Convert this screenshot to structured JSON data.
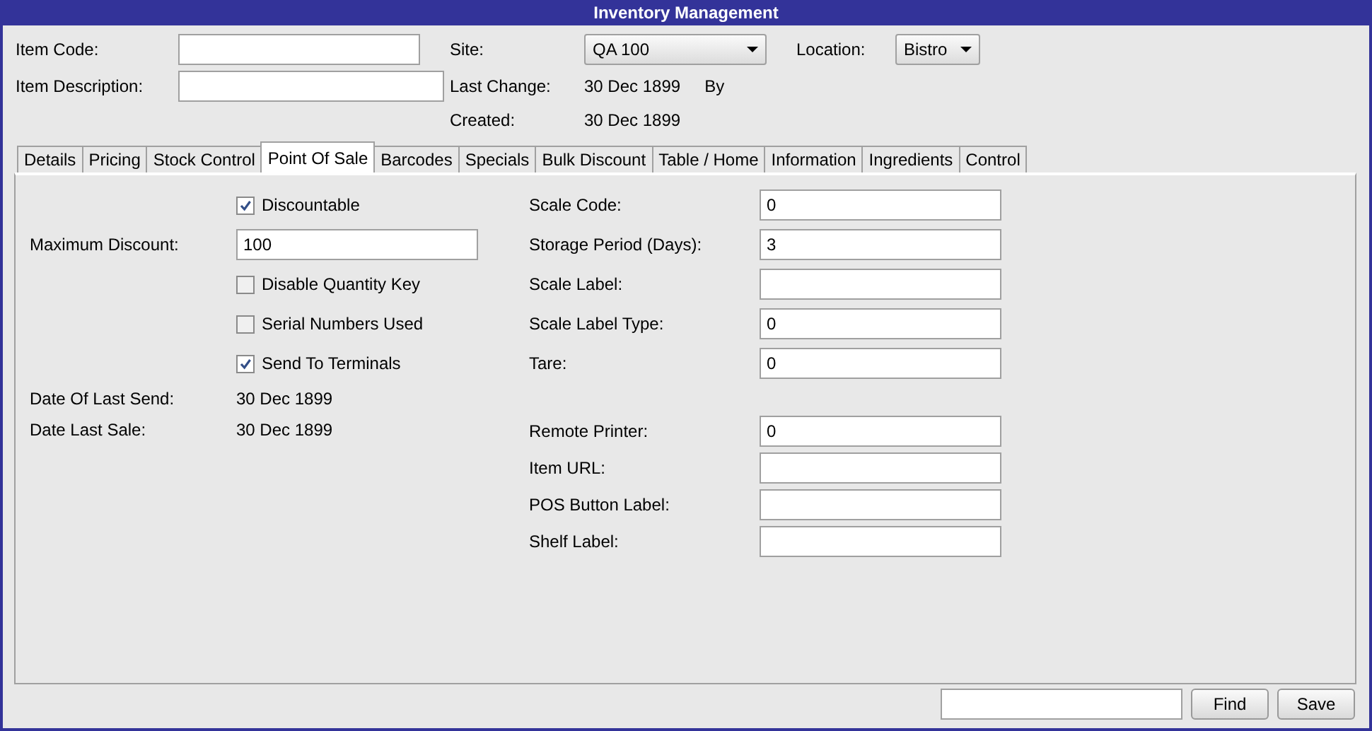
{
  "window": {
    "title": "Inventory Management"
  },
  "header": {
    "item_code": {
      "label": "Item Code:"
    },
    "item_description": {
      "label": "Item Description:"
    },
    "site": {
      "label": "Site:",
      "value": "QA 100"
    },
    "location": {
      "label": "Location:",
      "value": "Bistro"
    },
    "last_change": {
      "label": "Last Change:",
      "value": "30 Dec 1899",
      "by": "By"
    },
    "created": {
      "label": "Created:",
      "value": "30 Dec 1899"
    }
  },
  "tabs": [
    {
      "label": "Details",
      "selected": false
    },
    {
      "label": "Pricing",
      "selected": false
    },
    {
      "label": "Stock Control",
      "selected": false
    },
    {
      "label": "Point Of Sale",
      "selected": true
    },
    {
      "label": "Barcodes",
      "selected": false
    },
    {
      "label": "Specials",
      "selected": false
    },
    {
      "label": "Bulk Discount",
      "selected": false
    },
    {
      "label": "Table / Home",
      "selected": false
    },
    {
      "label": "Information",
      "selected": false
    },
    {
      "label": "Ingredients",
      "selected": false
    },
    {
      "label": "Control",
      "selected": false
    }
  ],
  "left": [
    {
      "kind": "checkbox",
      "label": "Discountable",
      "checked": true
    },
    {
      "kind": "field",
      "label": "Maximum Discount:",
      "value": "100"
    },
    {
      "kind": "checkbox",
      "label": "Disable Quantity Key",
      "checked": false
    },
    {
      "kind": "checkbox",
      "label": "Serial Numbers Used",
      "checked": false
    },
    {
      "kind": "checkbox",
      "label": "Send To Terminals",
      "checked": true
    },
    {
      "kind": "info",
      "label": "Date Of Last Send:",
      "value": "30 Dec 1899"
    },
    {
      "kind": "info",
      "label": "Date Last Sale:",
      "value": "30 Dec 1899"
    }
  ],
  "scale_fields": [
    {
      "label": "Scale Code:",
      "value": "0"
    },
    {
      "label": "Storage Period (Days):",
      "value": "3"
    },
    {
      "label": "Scale Label:"
    },
    {
      "label": "Scale Label Type:",
      "value": "0"
    },
    {
      "label": "Tare:",
      "value": "0"
    }
  ],
  "other_fields": [
    {
      "label": "Remote Printer:",
      "value": "0"
    },
    {
      "label": "Item URL:"
    },
    {
      "label": "POS Button Label:"
    },
    {
      "label": "Shelf Label:"
    }
  ],
  "footer": {
    "buttons": [
      "Find",
      "Save"
    ]
  }
}
